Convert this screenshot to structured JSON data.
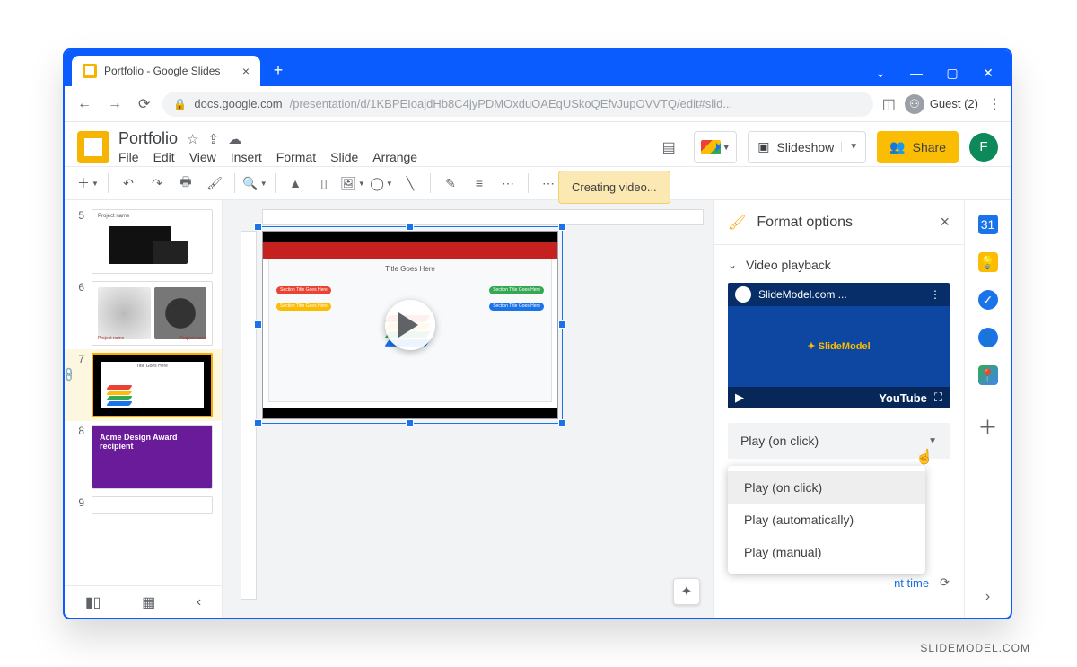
{
  "browser": {
    "tab_title": "Portfolio - Google Slides",
    "url_prefix": "docs.google.com",
    "url_rest": "/presentation/d/1KBPEIoajdHb8C4jyPDMOxduOAEqUSkoQEfvJupOVVTQ/edit#slid...",
    "guest_label": "Guest (2)"
  },
  "app": {
    "doc_title": "Portfolio",
    "menus": [
      "File",
      "Edit",
      "View",
      "Insert",
      "Format",
      "Slide",
      "Arrange"
    ],
    "tooltip": "Creating video...",
    "slideshow_label": "Slideshow",
    "share_label": "Share",
    "avatar_letter": "F"
  },
  "filmstrip": {
    "items": [
      {
        "num": "5",
        "kind": "devices"
      },
      {
        "num": "6",
        "kind": "projects"
      },
      {
        "num": "7",
        "kind": "video",
        "selected": true,
        "thumb_title": "Title Goes Here"
      },
      {
        "num": "8",
        "kind": "purple",
        "text": "Acme Design Award recipient"
      },
      {
        "num": "9",
        "kind": "blank"
      }
    ]
  },
  "canvas": {
    "frame_title": "Title Goes Here",
    "pill_labels": [
      "Section Title Goes Here",
      "Section Title Goes Here",
      "Section Title Goes Here",
      "Section Title Goes Here"
    ]
  },
  "format_panel": {
    "title": "Format options",
    "section": "Video playback",
    "yt_title": "SlideModel.com ...",
    "yt_brand": "SlideModel",
    "yt_label": "YouTube",
    "selected_option": "Play (on click)",
    "options": [
      "Play (on click)",
      "Play (automatically)",
      "Play (manual)"
    ],
    "time_label": "nt time"
  },
  "watermark": "SLIDEMODEL.COM"
}
